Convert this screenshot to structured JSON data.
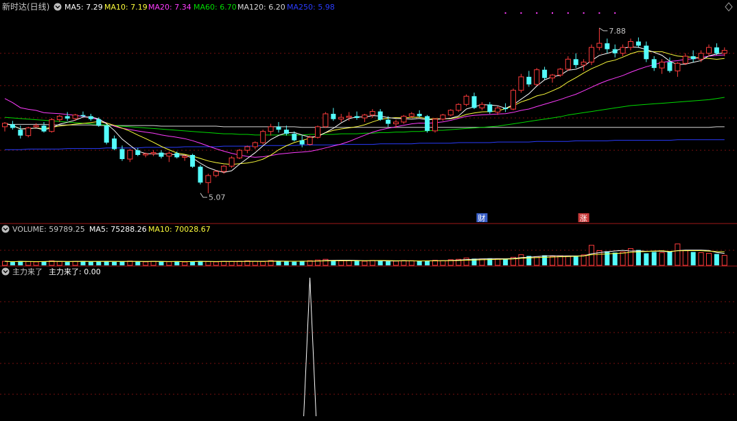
{
  "colors": {
    "bg": "#000000",
    "up": "#ff3b3b",
    "down": "#54fcfc",
    "grid": "#7a1010",
    "separator": "#a01818",
    "ma5": "#ffffff",
    "ma10": "#ffff3c",
    "ma20": "#ff3cff",
    "ma60": "#00dc00",
    "ma120": "#d8d8d8",
    "ma250": "#2a3cff",
    "vol_ma5": "#ffffff",
    "vol_ma10": "#ffff3c",
    "signal": "#ffffff",
    "badge_fin": "#3a60c8",
    "badge_up": "#c83a3a"
  },
  "header": {
    "icon": "circle-chevron-down-icon",
    "title": "新时达(日线)",
    "ma5": "MA5: 7.29",
    "ma10": "MA10: 7.19",
    "ma20": "MA20: 7.34",
    "ma60": "MA60: 6.70",
    "ma120": "MA120: 6.20",
    "ma250": "MA250: 5.98",
    "right_icon": "diamond-icon"
  },
  "volume_header": {
    "volume": "VOLUME: 59789.25",
    "ma5": "MA5: 75288.26",
    "ma10": "MA10: 70028.67"
  },
  "indicator_header": {
    "name": "主力来了",
    "value": "主力来了: 0.00"
  },
  "annotations": {
    "high": "7.88",
    "low": "5.07",
    "badge_fin": "财",
    "badge_up": "涨"
  },
  "chart_data": [
    {
      "panel": "price",
      "type": "candlestick",
      "title": "新时达(日线)",
      "ylim": [
        4.6,
        8.1
      ],
      "gridlines": [
        5.8,
        6.35,
        6.9,
        7.45
      ],
      "annotations": [
        {
          "text": "7.88",
          "bar": 76,
          "value": 7.88
        },
        {
          "text": "5.07",
          "bar": 25,
          "value": 5.07
        }
      ],
      "badges": [
        {
          "text": "财",
          "bar": 61
        },
        {
          "text": "涨",
          "bar": 74
        }
      ],
      "candles": [
        [
          6.2,
          6.28,
          6.12,
          6.26
        ],
        [
          6.24,
          6.3,
          6.15,
          6.18
        ],
        [
          6.15,
          6.22,
          6.0,
          6.05
        ],
        [
          6.05,
          6.2,
          6.02,
          6.18
        ],
        [
          6.2,
          6.26,
          6.18,
          6.22
        ],
        [
          6.22,
          6.28,
          6.1,
          6.12
        ],
        [
          6.12,
          6.35,
          6.1,
          6.32
        ],
        [
          6.32,
          6.4,
          6.28,
          6.38
        ],
        [
          6.38,
          6.45,
          6.3,
          6.34
        ],
        [
          6.34,
          6.42,
          6.3,
          6.4
        ],
        [
          6.4,
          6.46,
          6.36,
          6.38
        ],
        [
          6.38,
          6.42,
          6.3,
          6.33
        ],
        [
          6.33,
          6.36,
          6.2,
          6.22
        ],
        [
          6.22,
          6.24,
          5.9,
          5.93
        ],
        [
          6.0,
          6.05,
          5.8,
          5.82
        ],
        [
          5.82,
          5.88,
          5.62,
          5.65
        ],
        [
          5.65,
          5.82,
          5.6,
          5.8
        ],
        [
          5.8,
          5.84,
          5.7,
          5.72
        ],
        [
          5.72,
          5.76,
          5.68,
          5.74
        ],
        [
          5.74,
          5.8,
          5.7,
          5.76
        ],
        [
          5.76,
          5.8,
          5.66,
          5.69
        ],
        [
          5.7,
          5.78,
          5.6,
          5.75
        ],
        [
          5.75,
          5.78,
          5.66,
          5.68
        ],
        [
          5.68,
          5.72,
          5.62,
          5.7
        ],
        [
          5.72,
          5.74,
          5.5,
          5.52
        ],
        [
          5.52,
          5.55,
          5.22,
          5.25
        ],
        [
          5.25,
          5.4,
          5.07,
          5.37
        ],
        [
          5.37,
          5.46,
          5.34,
          5.44
        ],
        [
          5.44,
          5.55,
          5.4,
          5.53
        ],
        [
          5.53,
          5.7,
          5.5,
          5.67
        ],
        [
          5.67,
          5.82,
          5.65,
          5.8
        ],
        [
          5.8,
          5.88,
          5.75,
          5.86
        ],
        [
          5.86,
          5.95,
          5.82,
          5.93
        ],
        [
          5.93,
          6.15,
          5.9,
          6.12
        ],
        [
          6.12,
          6.25,
          6.05,
          6.2
        ],
        [
          6.2,
          6.28,
          6.1,
          6.15
        ],
        [
          6.15,
          6.22,
          6.05,
          6.08
        ],
        [
          6.08,
          6.12,
          5.95,
          5.97
        ],
        [
          5.97,
          6.05,
          5.85,
          5.9
        ],
        [
          5.9,
          6.05,
          5.88,
          6.02
        ],
        [
          6.02,
          6.22,
          6.0,
          6.2
        ],
        [
          6.2,
          6.45,
          6.18,
          6.42
        ],
        [
          6.42,
          6.52,
          6.3,
          6.33
        ],
        [
          6.33,
          6.42,
          6.28,
          6.36
        ],
        [
          6.36,
          6.45,
          6.3,
          6.38
        ],
        [
          6.38,
          6.46,
          6.32,
          6.35
        ],
        [
          6.35,
          6.42,
          6.28,
          6.4
        ],
        [
          6.4,
          6.5,
          6.35,
          6.46
        ],
        [
          6.46,
          6.5,
          6.3,
          6.32
        ],
        [
          6.32,
          6.38,
          6.2,
          6.25
        ],
        [
          6.25,
          6.32,
          6.18,
          6.28
        ],
        [
          6.28,
          6.4,
          6.25,
          6.38
        ],
        [
          6.38,
          6.45,
          6.35,
          6.42
        ],
        [
          6.42,
          6.48,
          6.36,
          6.38
        ],
        [
          6.38,
          6.4,
          6.1,
          6.13
        ],
        [
          6.13,
          6.35,
          6.1,
          6.33
        ],
        [
          6.33,
          6.42,
          6.3,
          6.4
        ],
        [
          6.4,
          6.5,
          6.38,
          6.48
        ],
        [
          6.48,
          6.6,
          6.45,
          6.58
        ],
        [
          6.58,
          6.75,
          6.55,
          6.72
        ],
        [
          6.72,
          6.78,
          6.5,
          6.52
        ],
        [
          6.52,
          6.62,
          6.48,
          6.58
        ],
        [
          6.58,
          6.62,
          6.42,
          6.45
        ],
        [
          6.45,
          6.55,
          6.4,
          6.52
        ],
        [
          6.52,
          6.6,
          6.45,
          6.5
        ],
        [
          6.5,
          6.85,
          6.48,
          6.82
        ],
        [
          6.82,
          7.1,
          6.78,
          7.05
        ],
        [
          7.05,
          7.15,
          6.88,
          6.92
        ],
        [
          6.92,
          7.2,
          6.9,
          7.17
        ],
        [
          7.17,
          7.22,
          7.0,
          7.03
        ],
        [
          7.03,
          7.1,
          6.95,
          7.08
        ],
        [
          7.08,
          7.2,
          7.05,
          7.18
        ],
        [
          7.18,
          7.4,
          7.15,
          7.35
        ],
        [
          7.35,
          7.45,
          7.2,
          7.25
        ],
        [
          7.25,
          7.35,
          7.15,
          7.3
        ],
        [
          7.3,
          7.6,
          7.25,
          7.55
        ],
        [
          7.55,
          7.88,
          7.5,
          7.62
        ],
        [
          7.62,
          7.7,
          7.45,
          7.52
        ],
        [
          7.52,
          7.6,
          7.38,
          7.45
        ],
        [
          7.45,
          7.6,
          7.4,
          7.55
        ],
        [
          7.55,
          7.7,
          7.5,
          7.65
        ],
        [
          7.65,
          7.72,
          7.55,
          7.58
        ],
        [
          7.58,
          7.65,
          7.3,
          7.35
        ],
        [
          7.35,
          7.4,
          7.15,
          7.2
        ],
        [
          7.2,
          7.35,
          7.1,
          7.3
        ],
        [
          7.3,
          7.38,
          7.12,
          7.15
        ],
        [
          7.15,
          7.3,
          7.05,
          7.28
        ],
        [
          7.28,
          7.45,
          7.25,
          7.4
        ],
        [
          7.4,
          7.5,
          7.3,
          7.35
        ],
        [
          7.35,
          7.5,
          7.3,
          7.45
        ],
        [
          7.45,
          7.6,
          7.4,
          7.55
        ],
        [
          7.55,
          7.62,
          7.42,
          7.45
        ],
        [
          7.45,
          7.55,
          7.4,
          7.5
        ]
      ],
      "series": [
        {
          "name": "MA5",
          "value_label": "7.29"
        },
        {
          "name": "MA10",
          "value_label": "7.19"
        },
        {
          "name": "MA20",
          "value_label": "7.34"
        },
        {
          "name": "MA60",
          "value_label": "6.70",
          "values": [
            6.36,
            6.35,
            6.34,
            6.33,
            6.32,
            6.31,
            6.3,
            6.29,
            6.28,
            6.27,
            6.26,
            6.25,
            6.24,
            6.23,
            6.22,
            6.21,
            6.2,
            6.19,
            6.18,
            6.17,
            6.16,
            6.15,
            6.14,
            6.13,
            6.12,
            6.11,
            6.1,
            6.09,
            6.08,
            6.08,
            6.07,
            6.07,
            6.06,
            6.06,
            6.06,
            6.06,
            6.06,
            6.06,
            6.06,
            6.07,
            6.07,
            6.07,
            6.07,
            6.08,
            6.08,
            6.08,
            6.09,
            6.09,
            6.1,
            6.1,
            6.11,
            6.11,
            6.12,
            6.12,
            6.13,
            6.14,
            6.14,
            6.15,
            6.16,
            6.17,
            6.18,
            6.19,
            6.2,
            6.21,
            6.23,
            6.25,
            6.27,
            6.29,
            6.31,
            6.33,
            6.35,
            6.37,
            6.4,
            6.42,
            6.44,
            6.46,
            6.48,
            6.5,
            6.52,
            6.54,
            6.56,
            6.57,
            6.58,
            6.59,
            6.6,
            6.61,
            6.62,
            6.63,
            6.64,
            6.65,
            6.66,
            6.68,
            6.7
          ]
        },
        {
          "name": "MA120",
          "value_label": "6.20",
          "values": [
            6.24,
            6.24,
            6.24,
            6.24,
            6.24,
            6.24,
            6.23,
            6.23,
            6.23,
            6.23,
            6.23,
            6.23,
            6.22,
            6.22,
            6.22,
            6.22,
            6.22,
            6.22,
            6.22,
            6.22,
            6.21,
            6.21,
            6.21,
            6.21,
            6.21,
            6.21,
            6.21,
            6.21,
            6.2,
            6.2,
            6.2,
            6.2,
            6.2,
            6.2,
            6.2,
            6.2,
            6.2,
            6.2,
            6.19,
            6.19,
            6.19,
            6.19,
            6.19,
            6.19,
            6.19,
            6.19,
            6.19,
            6.19,
            6.19,
            6.19,
            6.19,
            6.19,
            6.19,
            6.19,
            6.19,
            6.19,
            6.19,
            6.19,
            6.19,
            6.19,
            6.19,
            6.19,
            6.19,
            6.19,
            6.19,
            6.19,
            6.19,
            6.19,
            6.19,
            6.19,
            6.19,
            6.19,
            6.19,
            6.19,
            6.19,
            6.19,
            6.19,
            6.19,
            6.19,
            6.19,
            6.19,
            6.19,
            6.19,
            6.19,
            6.19,
            6.19,
            6.19,
            6.19,
            6.19,
            6.19,
            6.19,
            6.2,
            6.2
          ]
        },
        {
          "name": "MA250",
          "value_label": "5.98",
          "values": [
            5.81,
            5.81,
            5.81,
            5.82,
            5.82,
            5.82,
            5.82,
            5.82,
            5.83,
            5.83,
            5.83,
            5.83,
            5.83,
            5.84,
            5.84,
            5.84,
            5.84,
            5.84,
            5.85,
            5.85,
            5.85,
            5.85,
            5.85,
            5.86,
            5.86,
            5.86,
            5.86,
            5.86,
            5.87,
            5.87,
            5.87,
            5.87,
            5.87,
            5.88,
            5.88,
            5.88,
            5.88,
            5.88,
            5.89,
            5.89,
            5.89,
            5.89,
            5.89,
            5.9,
            5.9,
            5.9,
            5.9,
            5.9,
            5.91,
            5.91,
            5.91,
            5.91,
            5.91,
            5.92,
            5.92,
            5.92,
            5.92,
            5.92,
            5.93,
            5.93,
            5.93,
            5.93,
            5.93,
            5.94,
            5.94,
            5.94,
            5.94,
            5.94,
            5.95,
            5.95,
            5.95,
            5.95,
            5.95,
            5.96,
            5.96,
            5.96,
            5.96,
            5.96,
            5.97,
            5.97,
            5.97,
            5.97,
            5.97,
            5.97,
            5.97,
            5.97,
            5.98,
            5.98,
            5.98,
            5.98,
            5.98,
            5.98,
            5.98
          ]
        }
      ]
    },
    {
      "panel": "volume",
      "type": "bar",
      "title": "VOLUME",
      "ylim": [
        0,
        210000
      ],
      "values": [
        30000,
        25000,
        32000,
        28000,
        26000,
        30000,
        34000,
        28000,
        25000,
        30000,
        33000,
        27000,
        31000,
        29000,
        26000,
        30000,
        32000,
        28000,
        26000,
        30000,
        29000,
        27000,
        31000,
        25000,
        30000,
        33000,
        28000,
        26000,
        30000,
        29000,
        31000,
        34000,
        30000,
        28000,
        36000,
        32000,
        29000,
        27000,
        31000,
        35000,
        40000,
        45000,
        38000,
        34000,
        36000,
        33000,
        31000,
        37000,
        34000,
        30000,
        32000,
        36000,
        35000,
        31000,
        34000,
        38000,
        36000,
        42000,
        45000,
        55000,
        50000,
        48000,
        52000,
        46000,
        50000,
        60000,
        80000,
        70000,
        65000,
        75000,
        68000,
        72000,
        70000,
        66000,
        78000,
        150000,
        110000,
        105000,
        95000,
        100000,
        125000,
        115000,
        90000,
        100000,
        95000,
        105000,
        160000,
        110000,
        100000,
        95000,
        90000,
        85000,
        75000
      ],
      "series": [
        {
          "name": "MA5",
          "value_label": "75288.26"
        },
        {
          "name": "MA10",
          "value_label": "70028.67"
        }
      ]
    },
    {
      "panel": "indicator",
      "type": "line",
      "title": "主力来了",
      "ylim": [
        0,
        1
      ],
      "series": [
        {
          "name": "主力来了",
          "value_label": "0.00",
          "values": [
            0,
            0,
            0,
            0,
            0,
            0,
            0,
            0,
            0,
            0,
            0,
            0,
            0,
            0,
            0,
            0,
            0,
            0,
            0,
            0,
            0,
            0,
            0,
            0,
            0,
            0,
            0,
            0,
            0,
            0,
            0,
            0,
            0,
            0,
            0,
            0,
            0,
            0,
            0,
            1,
            0,
            0,
            0,
            0,
            0,
            0,
            0,
            0,
            0,
            0,
            0,
            0,
            0,
            0,
            0,
            0,
            0,
            0,
            0,
            0,
            0,
            0,
            0,
            0,
            0,
            0,
            0,
            0,
            0,
            0,
            0,
            0,
            0,
            0,
            0,
            0,
            0,
            0,
            0,
            0,
            0,
            0,
            0,
            0,
            0,
            0,
            0,
            0,
            0,
            0,
            0,
            0,
            0
          ]
        }
      ]
    }
  ]
}
